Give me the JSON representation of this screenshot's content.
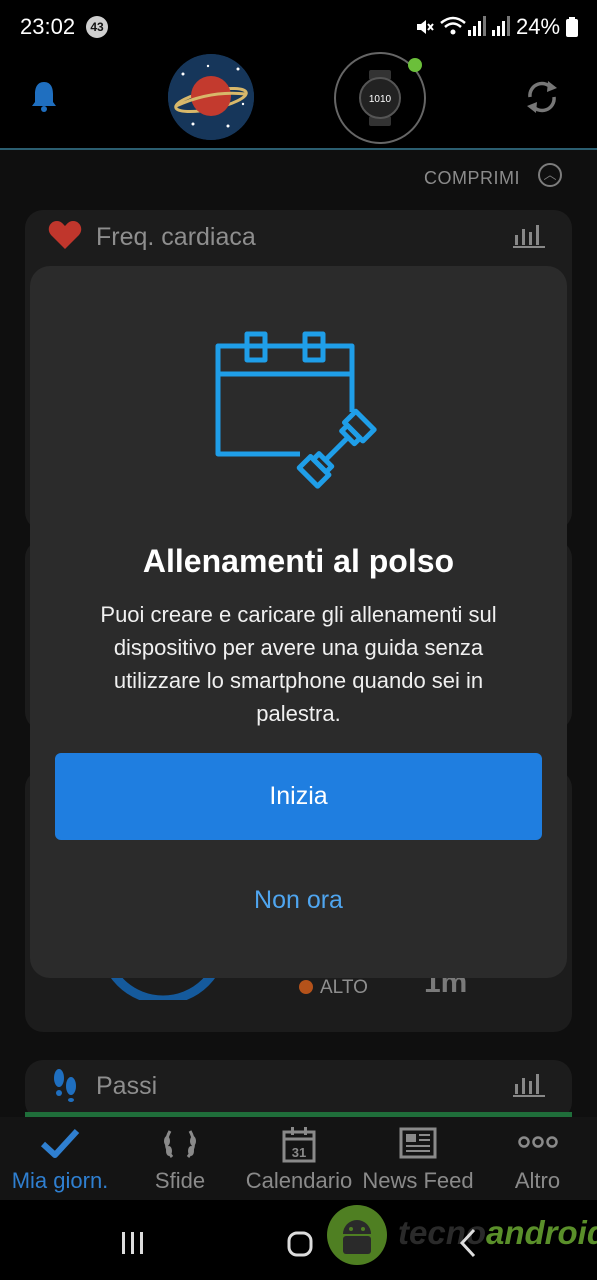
{
  "status_bar": {
    "time": "23:02",
    "notification_count": "43",
    "battery": "24%"
  },
  "background": {
    "collapse_label": "COMPRIMI",
    "heart_card_title": "Freq. cardiaca",
    "stress_level_label": "ALTO",
    "partial_value": "1m",
    "steps_card_title": "Passi"
  },
  "modal": {
    "title": "Allenamenti al polso",
    "body": "Puoi creare e caricare gli allenamenti sul dispositivo per avere una guida senza utilizzare lo smartphone quando sei in palestra.",
    "primary_label": "Inizia",
    "secondary_label": "Non ora"
  },
  "watch": {
    "face_text": "1010"
  },
  "bottom_nav": {
    "items": [
      {
        "label": "Mia giorn.",
        "icon": "check-icon",
        "active": true
      },
      {
        "label": "Sfide",
        "icon": "laurel-icon",
        "active": false
      },
      {
        "label": "Calendario",
        "icon": "calendar-icon",
        "active": false
      },
      {
        "label": "News Feed",
        "icon": "newspaper-icon",
        "active": false
      },
      {
        "label": "Altro",
        "icon": "more-icon",
        "active": false
      }
    ],
    "calendar_day": "31"
  },
  "watermark": {
    "part1": "tecno",
    "part2": "android"
  },
  "colors": {
    "accent_blue": "#1f7ee0",
    "link_blue": "#4fa5ef",
    "active_nav": "#2f7fd0",
    "heart_red": "#c0362c",
    "modal_bg": "#2b2b2b"
  }
}
